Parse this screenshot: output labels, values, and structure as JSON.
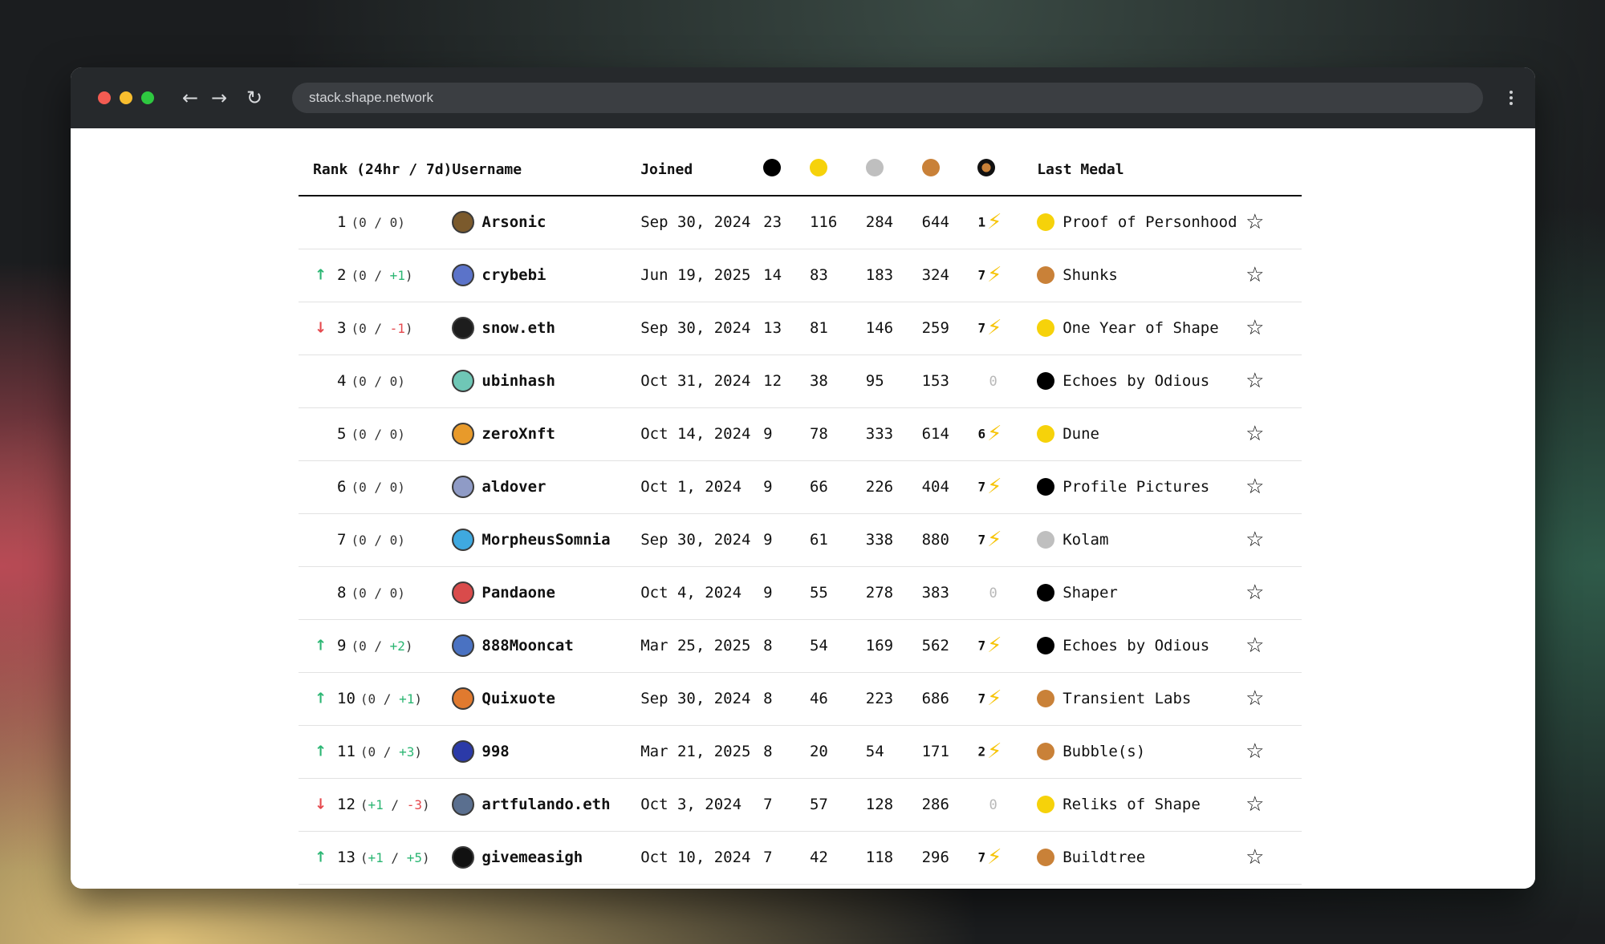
{
  "browser": {
    "url": "stack.shape.network"
  },
  "colors": {
    "black": "#000000",
    "gold": "#f6d20a",
    "silver": "#bfbfbf",
    "bronze": "#c98138",
    "bolt": "#f6c409",
    "up": "#2bb673",
    "down": "#e5484d"
  },
  "table": {
    "headers": {
      "rank": "Rank (24hr / 7d)",
      "username": "Username",
      "joined": "Joined",
      "last_medal": "Last Medal"
    },
    "rows": [
      {
        "trend": "none",
        "rank": "1",
        "d24": "0",
        "d7": "0",
        "username": "Arsonic",
        "avatar": "#7b5a2c",
        "joined": "Sep 30, 2024",
        "m1": "23",
        "m2": "116",
        "m3": "284",
        "m4": "644",
        "bolt": "1",
        "last_medal": "Proof of Personhood",
        "last_color": "#f6d20a"
      },
      {
        "trend": "up",
        "rank": "2",
        "d24": "0",
        "d7": "+1",
        "username": "crybebi",
        "avatar": "#5b73c9",
        "joined": "Jun 19, 2025",
        "m1": "14",
        "m2": "83",
        "m3": "183",
        "m4": "324",
        "bolt": "7",
        "last_medal": "Shunks",
        "last_color": "#c98138"
      },
      {
        "trend": "down",
        "rank": "3",
        "d24": "0",
        "d7": "-1",
        "username": "snow.eth",
        "avatar": "#1d1d1d",
        "joined": "Sep 30, 2024",
        "m1": "13",
        "m2": "81",
        "m3": "146",
        "m4": "259",
        "bolt": "7",
        "last_medal": "One Year of Shape",
        "last_color": "#f6d20a"
      },
      {
        "trend": "none",
        "rank": "4",
        "d24": "0",
        "d7": "0",
        "username": "ubinhash",
        "avatar": "#6fc7b6",
        "joined": "Oct 31, 2024",
        "m1": "12",
        "m2": "38",
        "m3": "95",
        "m4": "153",
        "bolt": "0",
        "last_medal": "Echoes by Odious",
        "last_color": "#000000"
      },
      {
        "trend": "none",
        "rank": "5",
        "d24": "0",
        "d7": "0",
        "username": "zeroXnft",
        "avatar": "#e89a2a",
        "joined": "Oct 14, 2024",
        "m1": "9",
        "m2": "78",
        "m3": "333",
        "m4": "614",
        "bolt": "6",
        "last_medal": "Dune",
        "last_color": "#f6d20a"
      },
      {
        "trend": "none",
        "rank": "6",
        "d24": "0",
        "d7": "0",
        "username": "aldover",
        "avatar": "#8f9bc6",
        "joined": "Oct 1, 2024",
        "m1": "9",
        "m2": "66",
        "m3": "226",
        "m4": "404",
        "bolt": "7",
        "last_medal": "Profile Pictures",
        "last_color": "#000000"
      },
      {
        "trend": "none",
        "rank": "7",
        "d24": "0",
        "d7": "0",
        "username": "MorpheusSomnia",
        "avatar": "#3fa9e0",
        "joined": "Sep 30, 2024",
        "m1": "9",
        "m2": "61",
        "m3": "338",
        "m4": "880",
        "bolt": "7",
        "last_medal": "Kolam",
        "last_color": "#bfbfbf"
      },
      {
        "trend": "none",
        "rank": "8",
        "d24": "0",
        "d7": "0",
        "username": "Pandaone",
        "avatar": "#d94b4b",
        "joined": "Oct 4, 2024",
        "m1": "9",
        "m2": "55",
        "m3": "278",
        "m4": "383",
        "bolt": "0",
        "last_medal": "Shaper",
        "last_color": "#000000"
      },
      {
        "trend": "up",
        "rank": "9",
        "d24": "0",
        "d7": "+2",
        "username": "888Mooncat",
        "avatar": "#4a72c2",
        "joined": "Mar 25, 2025",
        "m1": "8",
        "m2": "54",
        "m3": "169",
        "m4": "562",
        "bolt": "7",
        "last_medal": "Echoes by Odious",
        "last_color": "#000000"
      },
      {
        "trend": "up",
        "rank": "10",
        "d24": "0",
        "d7": "+1",
        "username": "Quixuote",
        "avatar": "#e07a2f",
        "joined": "Sep 30, 2024",
        "m1": "8",
        "m2": "46",
        "m3": "223",
        "m4": "686",
        "bolt": "7",
        "last_medal": "Transient Labs",
        "last_color": "#c98138"
      },
      {
        "trend": "up",
        "rank": "11",
        "d24": "0",
        "d7": "+3",
        "username": "998",
        "avatar": "#2b3aa8",
        "joined": "Mar 21, 2025",
        "m1": "8",
        "m2": "20",
        "m3": "54",
        "m4": "171",
        "bolt": "2",
        "last_medal": "Bubble(s)",
        "last_color": "#c98138"
      },
      {
        "trend": "down",
        "rank": "12",
        "d24": "+1",
        "d7": "-3",
        "username": "artfulando.eth",
        "avatar": "#5a6f8f",
        "joined": "Oct 3, 2024",
        "m1": "7",
        "m2": "57",
        "m3": "128",
        "m4": "286",
        "bolt": "0",
        "last_medal": "Reliks of Shape",
        "last_color": "#f6d20a"
      },
      {
        "trend": "up",
        "rank": "13",
        "d24": "+1",
        "d7": "+5",
        "username": "givemeasigh",
        "avatar": "#111111",
        "joined": "Oct 10, 2024",
        "m1": "7",
        "m2": "42",
        "m3": "118",
        "m4": "296",
        "bolt": "7",
        "last_medal": "Buildtree",
        "last_color": "#c98138"
      }
    ]
  }
}
